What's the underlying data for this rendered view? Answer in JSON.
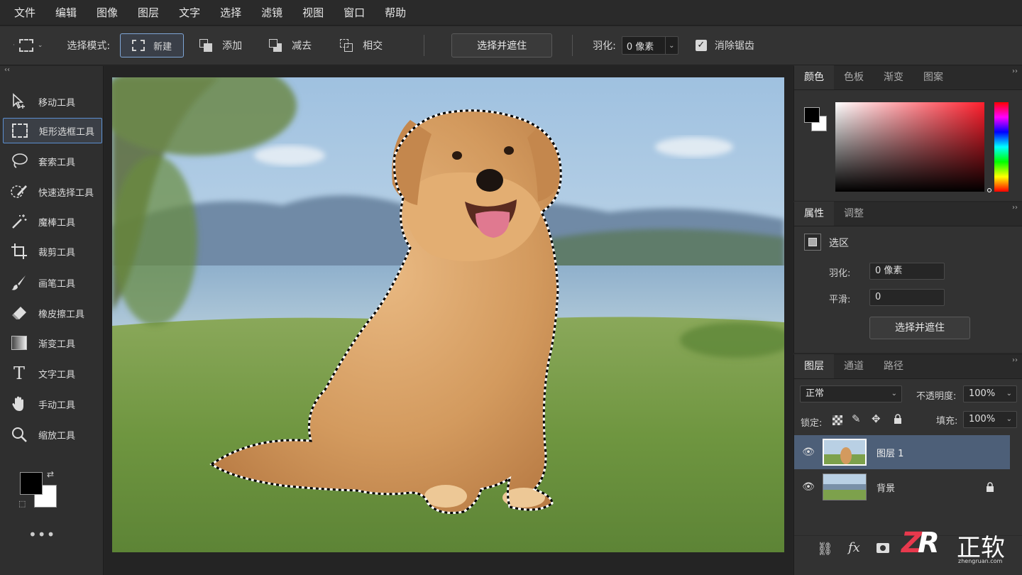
{
  "menu": [
    "文件",
    "编辑",
    "图像",
    "图层",
    "文字",
    "选择",
    "滤镜",
    "视图",
    "窗口",
    "帮助"
  ],
  "options": {
    "mode_label": "选择模式:",
    "modes": [
      "新建",
      "添加",
      "减去",
      "相交"
    ],
    "select_mask": "选择并遮住",
    "feather_label": "羽化:",
    "feather_value": "0 像素",
    "antialias_label": "消除锯齿"
  },
  "tools": [
    "移动工具",
    "矩形选框工具",
    "套索工具",
    "快速选择工具",
    "魔棒工具",
    "裁剪工具",
    "画笔工具",
    "橡皮擦工具",
    "渐变工具",
    "文字工具",
    "手动工具",
    "缩放工具"
  ],
  "active_tool_index": 1,
  "toolbar_more": "•••",
  "color_panel": {
    "tabs": [
      "颜色",
      "色板",
      "渐变",
      "图案"
    ]
  },
  "props_panel": {
    "tabs": [
      "属性",
      "调整"
    ],
    "section": "选区",
    "feather_label": "羽化:",
    "feather_value": "0 像素",
    "smooth_label": "平滑:",
    "smooth_value": "0",
    "button": "选择并遮住"
  },
  "layers_panel": {
    "tabs": [
      "图层",
      "通道",
      "路径"
    ],
    "blend_mode": "正常",
    "opacity_label": "不透明度:",
    "opacity_value": "100%",
    "lock_label": "锁定:",
    "fill_label": "填充:",
    "fill_value": "100%",
    "layers": [
      "图层 1",
      "背景"
    ],
    "fx_label": "fx"
  },
  "watermark": {
    "text": "正软",
    "sub": "zhengruan.com"
  },
  "colors": {
    "accent": "#5b8fd0",
    "selected_layer": "#4d5f78",
    "panel": "#323232"
  }
}
